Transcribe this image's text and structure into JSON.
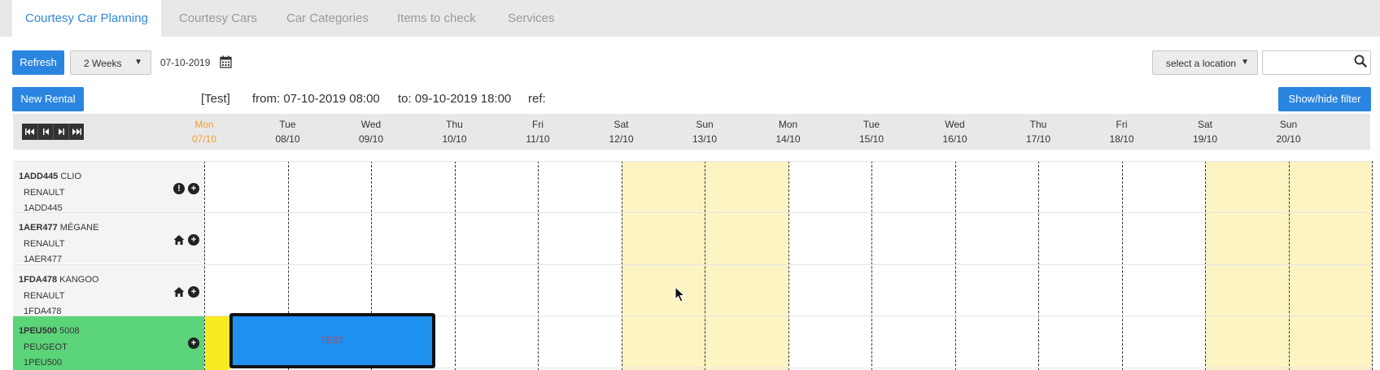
{
  "tabs": [
    {
      "label": "Courtesy Car Planning",
      "active": true
    },
    {
      "label": "Courtesy Cars",
      "active": false
    },
    {
      "label": "Car Categories",
      "active": false
    },
    {
      "label": "Items to check",
      "active": false
    },
    {
      "label": "Services",
      "active": false
    }
  ],
  "toolbar": {
    "refresh_label": "Refresh",
    "period_select": "2 Weeks",
    "date": "07-10-2019",
    "location_select": "select a location",
    "search_value": "",
    "calendar_icon": "calendar-icon",
    "search_icon": "search-icon"
  },
  "rental_bar": {
    "new_rental_label": "New Rental",
    "name": "[Test]",
    "from": "from: 07-10-2019 08:00",
    "to": "to: 09-10-2019 18:00",
    "ref": "ref:",
    "filter_label": "Show/hide filter"
  },
  "nav_icons": [
    "first-icon",
    "prev-icon",
    "next-icon",
    "last-icon"
  ],
  "days": [
    {
      "dow": "Mon",
      "date": "07/10",
      "today": true,
      "weekend": false
    },
    {
      "dow": "Tue",
      "date": "08/10",
      "today": false,
      "weekend": false
    },
    {
      "dow": "Wed",
      "date": "09/10",
      "today": false,
      "weekend": false
    },
    {
      "dow": "Thu",
      "date": "10/10",
      "today": false,
      "weekend": false
    },
    {
      "dow": "Fri",
      "date": "11/10",
      "today": false,
      "weekend": false
    },
    {
      "dow": "Sat",
      "date": "12/10",
      "today": false,
      "weekend": true
    },
    {
      "dow": "Sun",
      "date": "13/10",
      "today": false,
      "weekend": true
    },
    {
      "dow": "Mon",
      "date": "14/10",
      "today": false,
      "weekend": false
    },
    {
      "dow": "Tue",
      "date": "15/10",
      "today": false,
      "weekend": false
    },
    {
      "dow": "Wed",
      "date": "16/10",
      "today": false,
      "weekend": false
    },
    {
      "dow": "Thu",
      "date": "17/10",
      "today": false,
      "weekend": false
    },
    {
      "dow": "Fri",
      "date": "18/10",
      "today": false,
      "weekend": false
    },
    {
      "dow": "Sat",
      "date": "19/10",
      "today": false,
      "weekend": true
    },
    {
      "dow": "Sun",
      "date": "20/10",
      "today": false,
      "weekend": true
    }
  ],
  "cars": [
    {
      "plate_bold": "1ADD445",
      "model": "CLIO",
      "brand": "RENAULT",
      "plate": "1ADD445",
      "icons": [
        "warning-icon",
        "add-icon"
      ],
      "ready": false
    },
    {
      "plate_bold": "1AER477",
      "model": "MÉGANE",
      "brand": "RENAULT",
      "plate": "1AER477",
      "icons": [
        "home-icon",
        "add-icon"
      ],
      "ready": false
    },
    {
      "plate_bold": "1FDA478",
      "model": "KANGOO",
      "brand": "RENAULT",
      "plate": "1FDA478",
      "icons": [
        "home-icon",
        "add-icon"
      ],
      "ready": false
    },
    {
      "plate_bold": "1PEU500",
      "model": "5008",
      "brand": "PEUGEOT",
      "plate": "1PEU500",
      "icons": [
        "add-icon"
      ],
      "ready": true
    }
  ],
  "reservation": {
    "label": "TEST",
    "car": "1PEU500"
  },
  "colors": {
    "accent": "#2a85e0",
    "weekend": "#fdf4c3",
    "ready_row": "#5bd47a",
    "today": "#f0a030",
    "reservation_fill": "#1e90f0"
  }
}
